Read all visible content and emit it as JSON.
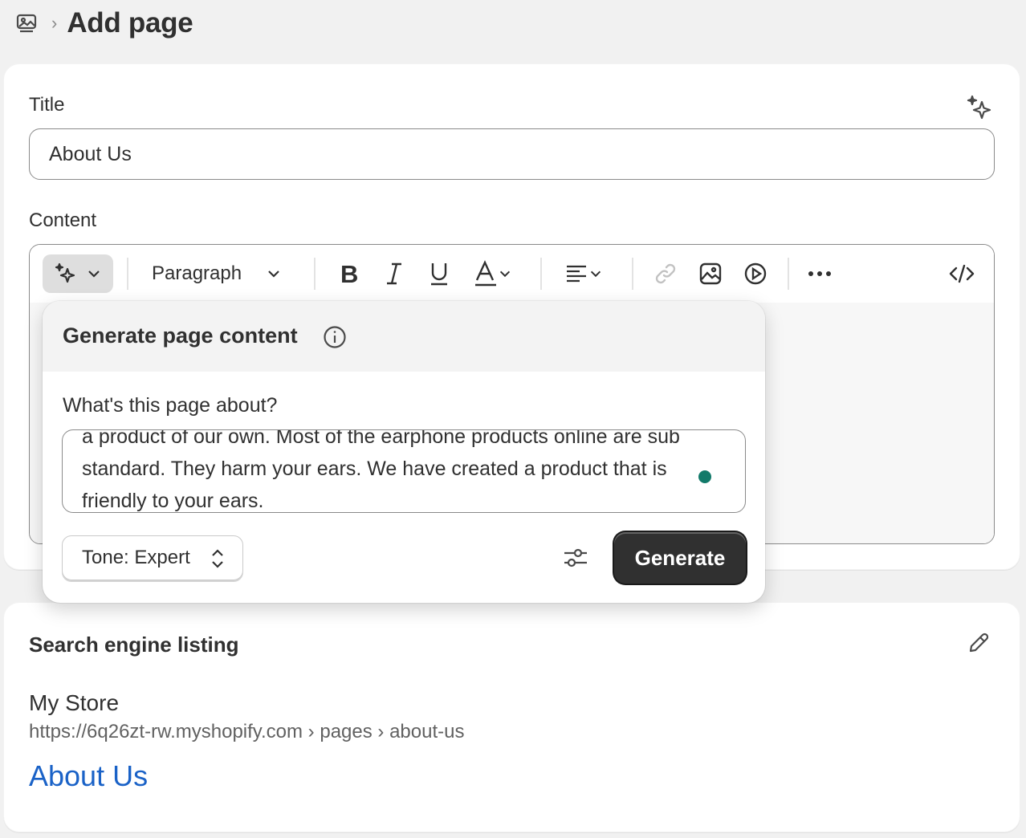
{
  "breadcrumb": {
    "separator": "›",
    "page_title": "Add page"
  },
  "form": {
    "title_label": "Title",
    "title_value": "About Us",
    "content_label": "Content"
  },
  "toolbar": {
    "paragraph_label": "Paragraph"
  },
  "generate_popover": {
    "title": "Generate page content",
    "question": "What's this page about?",
    "prompt_text": "a product of our own. Most of the earphone products online are sub standard. They harm your ears. We have created a product that is friendly to your ears.",
    "tone_label": "Tone: Expert",
    "generate_label": "Generate"
  },
  "seo": {
    "heading": "Search engine listing",
    "store_name": "My Store",
    "url": "https://6q26zt-rw.myshopify.com › pages › about-us",
    "page_link": "About Us"
  },
  "colors": {
    "primary_button": "#303030",
    "link": "#1a62c7",
    "cursor_dot": "#127a6a"
  }
}
